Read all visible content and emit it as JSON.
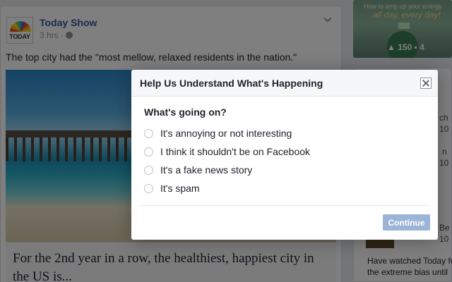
{
  "post": {
    "page_name": "Today Show",
    "logo_text": "TODAY",
    "time": "3 hrs ·",
    "text": "The top city had the \"most mellow, relaxed residents in the nation.\"",
    "headline_line1": "For the 2nd year in a row, the healthiest, happiest city in",
    "headline_line2": "the US is..."
  },
  "sidebar": {
    "ad_line1": "How to amp up your energy",
    "ad_line2": "all day, every day!",
    "ad_likes": "150",
    "ad_comments": "4",
    "right_fragments": [
      "ch",
      "10",
      "n",
      "10",
      "Be",
      "10"
    ],
    "story_line1": "Have watched Today fo",
    "story_line2": "the extreme bias until"
  },
  "dialog": {
    "title": "Help Us Understand What's Happening",
    "question": "What's going on?",
    "options": [
      "It's annoying or not interesting",
      "I think it shouldn't be on Facebook",
      "It's a fake news story",
      "It's spam"
    ],
    "continue_label": "Continue"
  },
  "colors": {
    "brand_link": "#365899",
    "continue_disabled": "#9cb4d8",
    "overlay": "rgba(0,0,0,0.5)"
  }
}
